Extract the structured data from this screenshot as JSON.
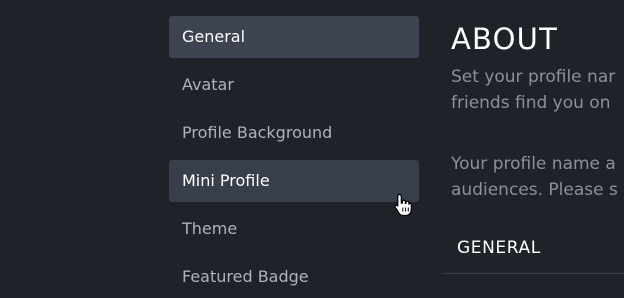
{
  "sidebar": {
    "items": [
      {
        "label": "General"
      },
      {
        "label": "Avatar"
      },
      {
        "label": "Profile Background"
      },
      {
        "label": "Mini Profile"
      },
      {
        "label": "Theme"
      },
      {
        "label": "Featured Badge"
      }
    ]
  },
  "main": {
    "title": "ABOUT",
    "intro_line1": "Set your profile nar",
    "intro_line2": "friends find you on",
    "note_line1": "Your profile name a",
    "note_line2": "audiences. Please s",
    "section_header": "GENERAL"
  },
  "colors": {
    "background": "#1f2329",
    "selected_item": "#3d4350",
    "hover_item": "#383e4a"
  },
  "icons": {
    "cursor": "hand-pointer-icon"
  }
}
